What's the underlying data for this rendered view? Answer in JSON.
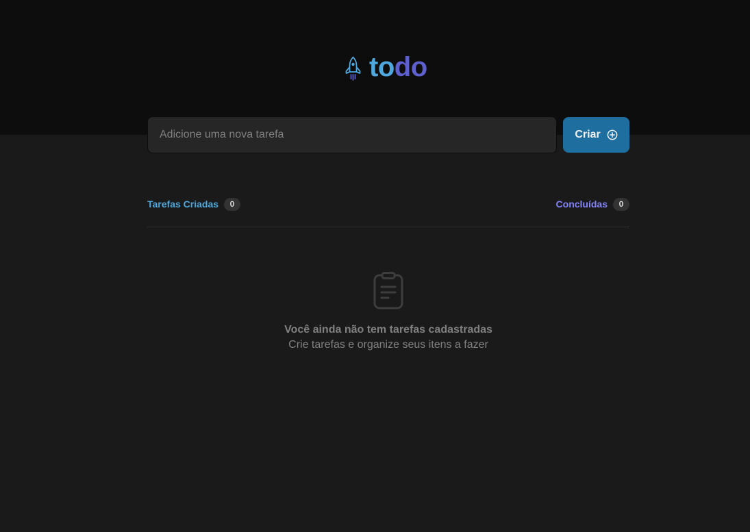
{
  "app": {
    "logo_part_1": "to",
    "logo_part_2": "do",
    "logo_icon": "rocket-icon"
  },
  "new_task": {
    "placeholder": "Adicione uma nova tarefa",
    "value": "",
    "button_label": "Criar",
    "button_icon": "plus-circle-icon"
  },
  "counters": {
    "created_label": "Tarefas Criadas",
    "created_count": "0",
    "done_label": "Concluídas",
    "done_count": "0"
  },
  "empty_state": {
    "icon": "clipboard-icon",
    "title": "Você ainda não tem tarefas cadastradas",
    "subtitle": "Crie tarefas e organize seus itens a fazer"
  },
  "colors": {
    "header_bg": "#0d0d0d",
    "page_bg": "#1a1a1a",
    "input_bg": "#262626",
    "button_bg": "#1e6f9f",
    "blue": "#4ea8de",
    "purple": "#5e60ce",
    "purple_light": "#8284fa",
    "gray_text": "#808080",
    "badge_bg": "#333333"
  }
}
